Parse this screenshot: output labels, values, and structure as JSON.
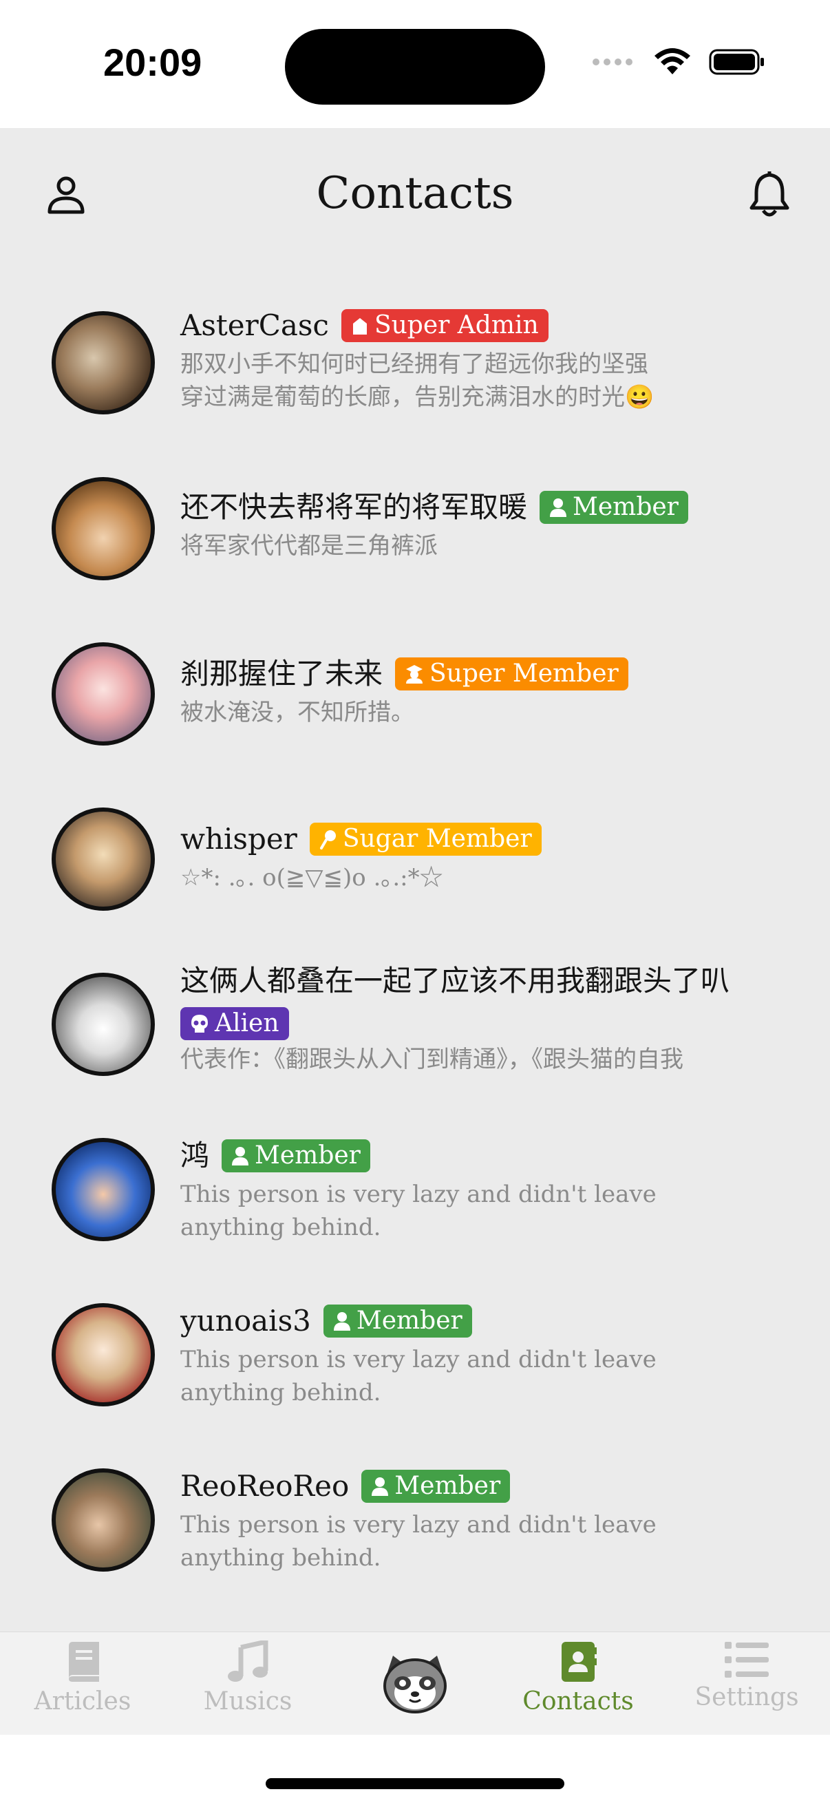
{
  "status": {
    "time": "20:09"
  },
  "header": {
    "title": "Contacts"
  },
  "colors": {
    "super_admin": "#e53935",
    "member": "#43a047",
    "super_member": "#fb8c00",
    "sugar_member": "#ffb300",
    "alien": "#5e35b1",
    "active_tab": "#5f8a2c"
  },
  "contacts": [
    {
      "name": "AsterCasc",
      "badge": {
        "label": "Super Admin",
        "icon": "admin-icon",
        "color": "#e53935"
      },
      "desc": "那双小手不知何时已经拥有了超远你我的坚强\n穿过满是葡萄的长廊，告别充满泪水的时光😀"
    },
    {
      "name": "还不快去帮将军的将军取暖",
      "badge": {
        "label": "Member",
        "icon": "person-icon",
        "color": "#43a047"
      },
      "desc": "将军家代代都是三角裤派"
    },
    {
      "name": "刹那握住了未来",
      "badge": {
        "label": "Super Member",
        "icon": "graduate-icon",
        "color": "#fb8c00"
      },
      "desc": "被水淹没，不知所措。"
    },
    {
      "name": "whisper",
      "badge": {
        "label": "Sugar Member",
        "icon": "lollipop-icon",
        "color": "#ffb300"
      },
      "desc": "☆*: .｡. o(≧▽≦)o .｡.:*☆"
    },
    {
      "name": "这俩人都叠在一起了应该不用我翻跟头了叭",
      "badge": {
        "label": "Alien",
        "icon": "skull-icon",
        "color": "#5e35b1"
      },
      "desc": "代表作：《翻跟头从入门到精通》，《跟头猫的自我"
    },
    {
      "name": "鸿",
      "badge": {
        "label": "Member",
        "icon": "person-icon",
        "color": "#43a047"
      },
      "desc": "This person is very lazy and didn't leave\nanything behind."
    },
    {
      "name": "yunoais3",
      "badge": {
        "label": "Member",
        "icon": "person-icon",
        "color": "#43a047"
      },
      "desc": "This person is very lazy and didn't leave\nanything behind."
    },
    {
      "name": "ReoReoReo",
      "badge": {
        "label": "Member",
        "icon": "person-icon",
        "color": "#43a047"
      },
      "desc": "This person is very lazy and didn't leave\nanything behind."
    }
  ],
  "tabs": [
    {
      "label": "Articles",
      "icon": "book-icon"
    },
    {
      "label": "Musics",
      "icon": "music-note-icon"
    },
    {
      "label": "",
      "icon": "red-panda-icon"
    },
    {
      "label": "Contacts",
      "icon": "address-book-icon",
      "active": true
    },
    {
      "label": "Settings",
      "icon": "list-icon"
    }
  ]
}
